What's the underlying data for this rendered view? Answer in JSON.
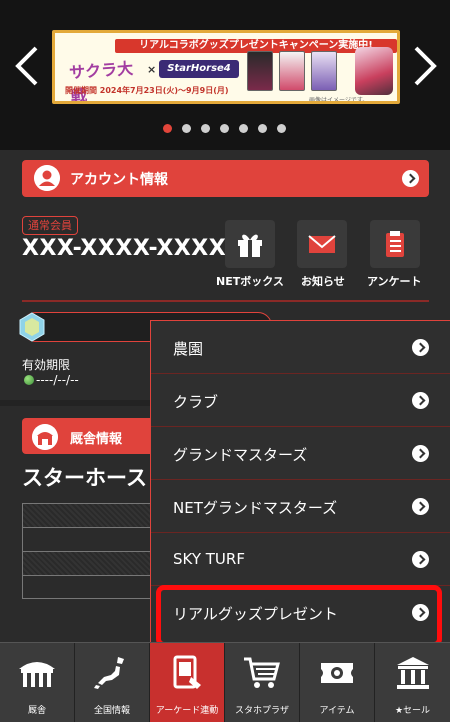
{
  "banner": {
    "headline": "リアルコラボグッズプレゼントキャンペーン実施中!",
    "collab_left": "サクラ大戦",
    "collab_x": "×",
    "collab_right": "StarHorse4",
    "period": "開催期間 2024年7月23日(火)～9月9日(月)",
    "note": "画像はイメージです。",
    "dots_count": 7,
    "active_dot": 0
  },
  "account": {
    "section_title": "アカウント情報",
    "member_badge": "通常会員",
    "account_id": "XXX-XXXX-XXXX",
    "quick_links": [
      {
        "label": "NETボックス",
        "icon": "gift-icon"
      },
      {
        "label": "お知らせ",
        "icon": "envelope-icon"
      },
      {
        "label": "アンケート",
        "icon": "clipboard-icon"
      }
    ],
    "expiry_label": "有効期限",
    "expiry_value": "----/--/--"
  },
  "stable": {
    "section_title": "厩舎情報",
    "name": "スターホース"
  },
  "menu": {
    "items": [
      {
        "label": "農園"
      },
      {
        "label": "クラブ"
      },
      {
        "label": "グランドマスターズ"
      },
      {
        "label": "NETグランドマスターズ"
      },
      {
        "label": "SKY TURF"
      },
      {
        "label": "リアルグッズプレゼント"
      }
    ],
    "highlighted_index": 5
  },
  "bottom_nav": {
    "items": [
      {
        "label": "厩舎",
        "icon": "stable-icon"
      },
      {
        "label": "全国情報",
        "icon": "japan-map-icon"
      },
      {
        "label": "アーケード連動",
        "icon": "arcade-link-icon"
      },
      {
        "label": "スタホプラザ",
        "icon": "cart-icon"
      },
      {
        "label": "アイテム",
        "icon": "item-ticket-icon"
      },
      {
        "label": "★セール",
        "icon": "sale-building-icon"
      }
    ],
    "active_index": 2
  },
  "colors": {
    "accent": "#e0433c",
    "highlight": "#ff0d0d",
    "background": "#2b2b2b"
  }
}
